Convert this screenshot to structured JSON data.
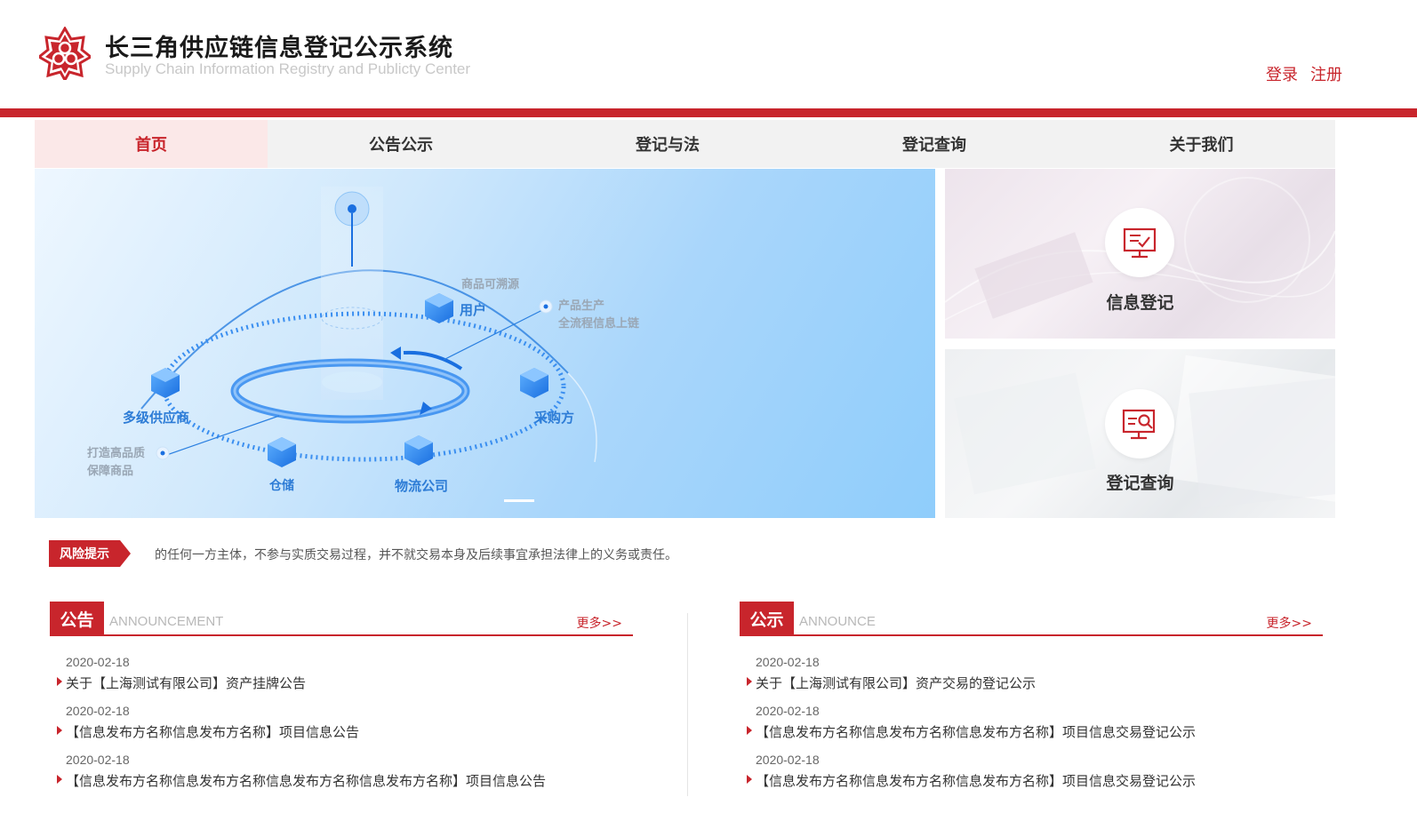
{
  "header": {
    "title": "长三角供应链信息登记公示系统",
    "subtitle": "Supply Chain Information Registry and Publicty Center",
    "login_label": "登录",
    "register_label": "注册"
  },
  "nav": {
    "items": [
      {
        "label": "首页"
      },
      {
        "label": "公告公示"
      },
      {
        "label": "登记与法"
      },
      {
        "label": "登记查询"
      },
      {
        "label": "关于我们"
      }
    ]
  },
  "banner": {
    "labels": {
      "traceable": "商品可溯源",
      "user": "用户",
      "production_line1": "产品生产",
      "production_line2": "全流程信息上链",
      "suppliers": "多级供应商",
      "purchaser": "采购方",
      "quality_line1": "打造高品质",
      "quality_line2": "保障商品",
      "warehouse": "仓储",
      "logistics": "物流公司"
    }
  },
  "cards": [
    {
      "label": "信息登记",
      "icon": "monitor-check-icon"
    },
    {
      "label": "登记查询",
      "icon": "monitor-search-icon"
    }
  ],
  "risk": {
    "tag": "风险提示",
    "text": "的任何一方主体，不参与实质交易过程，并不就交易本身及后续事宜承担法律上的义务或责任。"
  },
  "announcement": {
    "tag": "公告",
    "en": "ANNOUNCEMENT",
    "more": "更多>>",
    "items": [
      {
        "date": "2020-02-18",
        "title": "关于【上海测试有限公司】资产挂牌公告"
      },
      {
        "date": "2020-02-18",
        "title": "【信息发布方名称信息发布方名称】项目信息公告"
      },
      {
        "date": "2020-02-18",
        "title": "【信息发布方名称信息发布方名称信息发布方名称信息发布方名称】项目信息公告"
      }
    ]
  },
  "publicity": {
    "tag": "公示",
    "en": "ANNOUNCE",
    "more": "更多>>",
    "items": [
      {
        "date": "2020-02-18",
        "title": "关于【上海测试有限公司】资产交易的登记公示"
      },
      {
        "date": "2020-02-18",
        "title": "【信息发布方名称信息发布方名称信息发布方名称】项目信息交易登记公示"
      },
      {
        "date": "2020-02-18",
        "title": "【信息发布方名称信息发布方名称信息发布方名称】项目信息交易登记公示"
      }
    ]
  },
  "colors": {
    "brand_red": "#c8252c",
    "nav_bg": "#f2f2f2",
    "nav_active_bg": "#fbe8e8"
  }
}
